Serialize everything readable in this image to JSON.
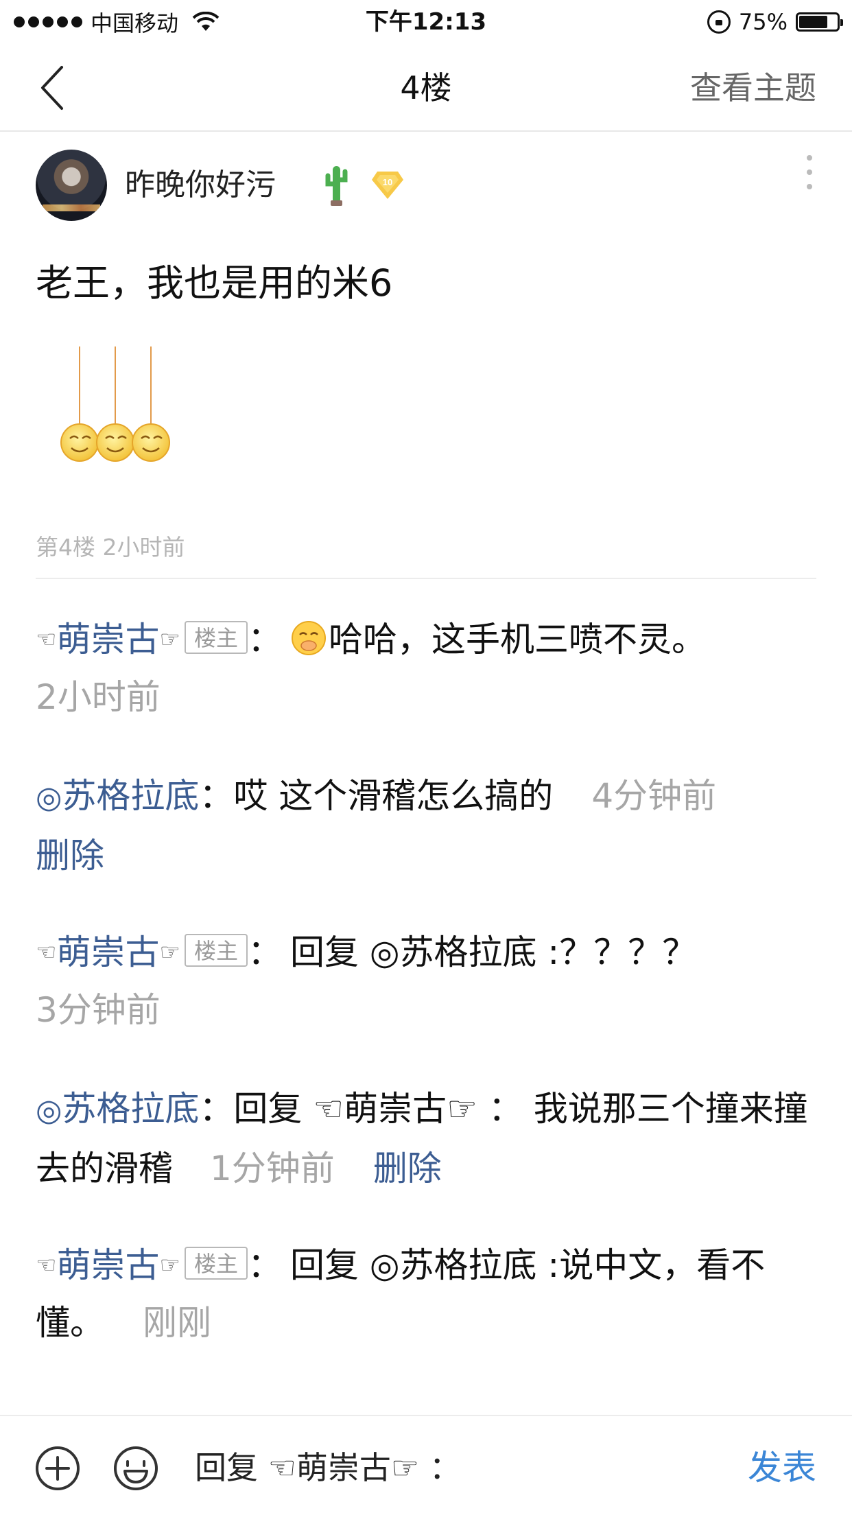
{
  "status_bar": {
    "carrier": "中国移动",
    "time": "下午12:13",
    "battery_percent": "75%",
    "battery_level": 0.75
  },
  "nav": {
    "title": "4楼",
    "action": "查看主题"
  },
  "post": {
    "username": "昨晚你好污",
    "level": "10",
    "text": "老王，我也是用的米6",
    "meta": "第4楼 2小时前"
  },
  "replies": [
    {
      "user_prefix": "☜",
      "user": "萌崇古",
      "user_suffix": "☞",
      "tag": "楼主",
      "colon": "：",
      "text": "哈哈，这手机三喷不灵。",
      "time": "2小时前"
    },
    {
      "user_prefix": "◎",
      "user": "苏格拉底",
      "colon": "：",
      "text": "哎 这个滑稽怎么搞的",
      "time": "4分钟前",
      "action": "删除"
    },
    {
      "user_prefix": "☜",
      "user": "萌崇古",
      "user_suffix": "☞",
      "tag": "楼主",
      "colon": "：",
      "text": "回复 ◎苏格拉底 :？？？？",
      "time": "3分钟前"
    },
    {
      "user_prefix": "◎",
      "user": "苏格拉底",
      "colon": "：",
      "text": "回复 ☜萌崇古☞ ： 我说那三个撞来撞去的滑稽",
      "time": "1分钟前",
      "action": "删除"
    },
    {
      "user_prefix": "☜",
      "user": "萌崇古",
      "user_suffix": "☞",
      "tag": "楼主",
      "colon": "：",
      "text": "回复 ◎苏格拉底 :说中文，看不懂。",
      "time": "刚刚"
    }
  ],
  "bottom_bar": {
    "input_value": "回复 ☜萌崇古☞ ：",
    "send_label": "发表"
  },
  "colors": {
    "username_blue": "#3c5d92",
    "send_blue": "#3b86d6",
    "meta_gray": "#a6a6a6"
  }
}
